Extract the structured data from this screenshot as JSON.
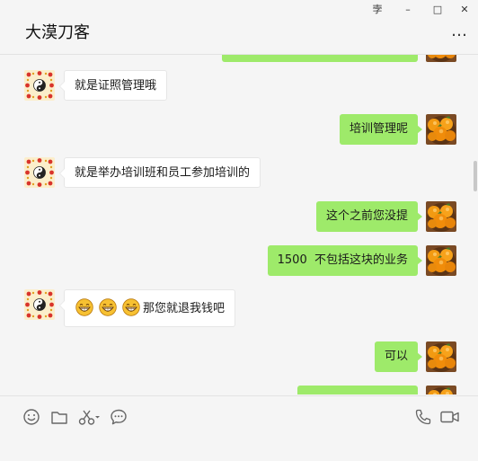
{
  "window": {
    "pin_glyph": "孛",
    "minimize_glyph": "–",
    "maximize_glyph": "□",
    "close_glyph": "✕"
  },
  "chat": {
    "title": "大漠刀客",
    "more_glyph": "…"
  },
  "messages": [
    {
      "side": "out",
      "text": ""
    },
    {
      "side": "in",
      "text": "就是证照管理哦"
    },
    {
      "side": "out",
      "text": "培训管理呢"
    },
    {
      "side": "in",
      "text": "就是举办培训班和员工参加培训的"
    },
    {
      "side": "out",
      "text": "这个之前您没提"
    },
    {
      "side": "out",
      "text": "1500  不包括这块的业务"
    },
    {
      "side": "in",
      "text": "那您就退我钱吧",
      "emoji": [
        "grin-emoji",
        "grin-emoji",
        "grin-emoji"
      ]
    },
    {
      "side": "out",
      "text": "可以"
    },
    {
      "side": "out",
      "text": ""
    }
  ],
  "toolbar": {
    "left_icons": [
      "emoji-icon",
      "folder-icon",
      "scissors-icon",
      "chat-bubble-icon"
    ],
    "right_icons": [
      "phone-icon",
      "video-icon"
    ]
  },
  "colors": {
    "outgoing_bubble": "#9eea6a",
    "incoming_bubble": "#ffffff",
    "background": "#f5f5f5"
  }
}
